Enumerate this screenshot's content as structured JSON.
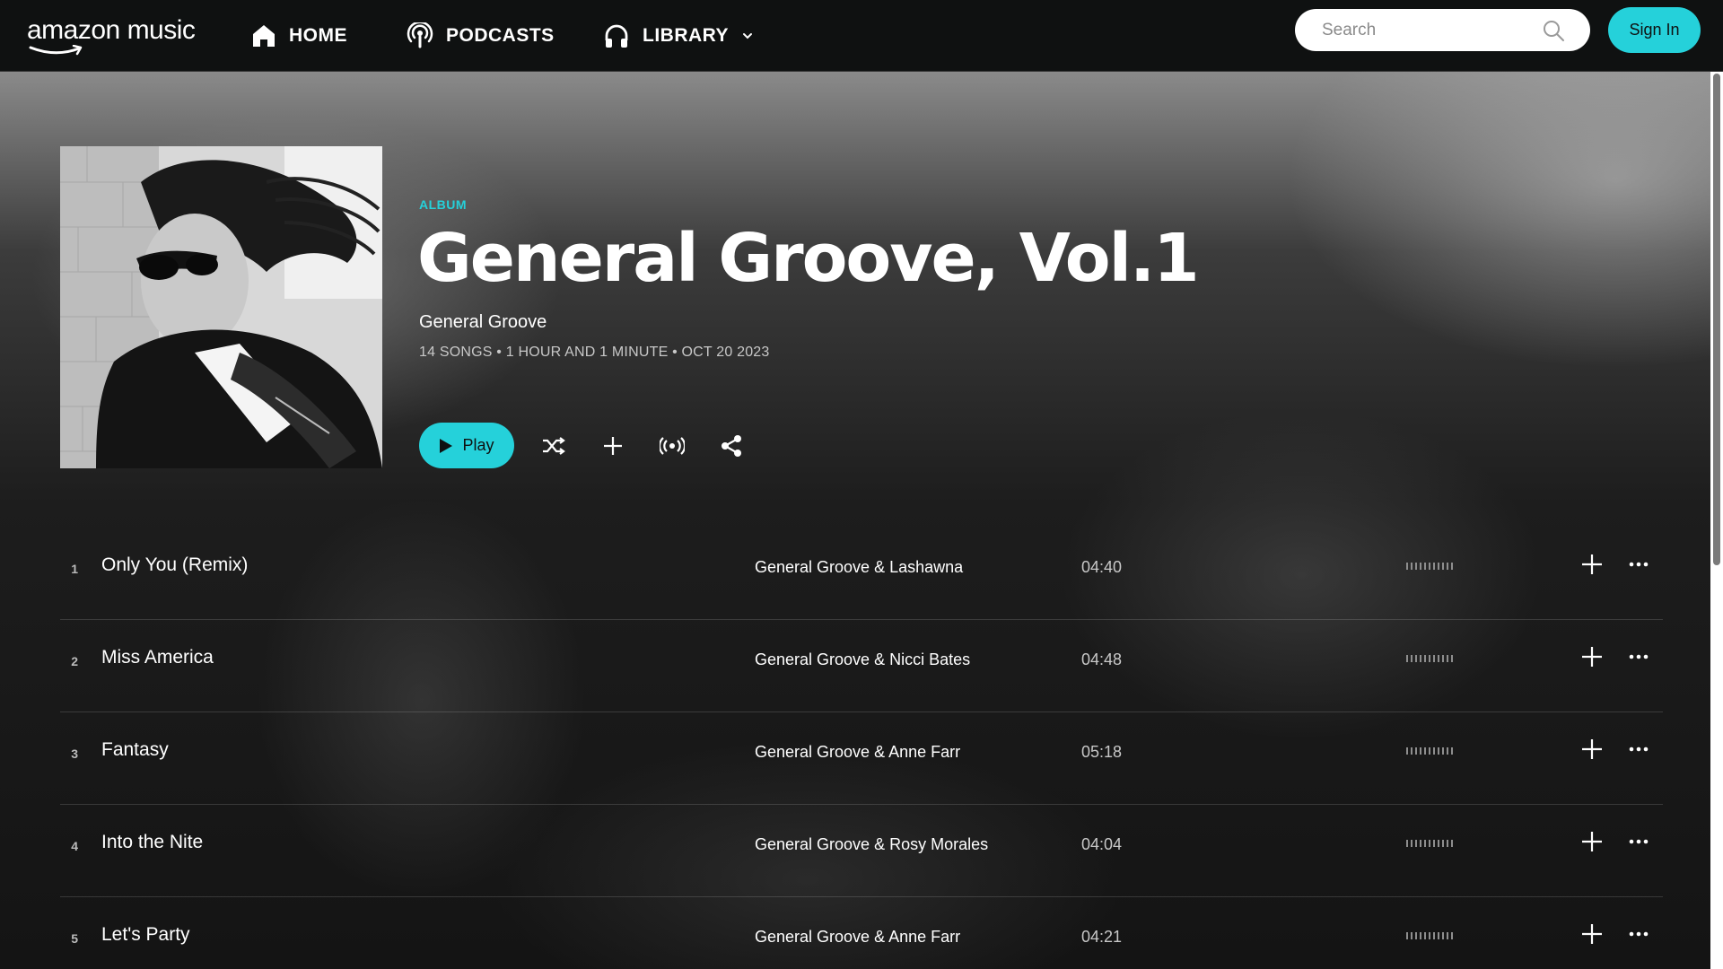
{
  "header": {
    "logo_text": "amazon music",
    "nav": [
      {
        "label": "HOME",
        "icon": "home-icon"
      },
      {
        "label": "PODCASTS",
        "icon": "podcast-icon"
      },
      {
        "label": "LIBRARY",
        "icon": "headphones-icon"
      }
    ],
    "search_placeholder": "Search",
    "signin_label": "Sign In"
  },
  "album": {
    "type_label": "ALBUM",
    "title": "General Groove, Vol.1",
    "artist": "General Groove",
    "meta": "14 SONGS • 1 HOUR AND 1 MINUTE • OCT 20 2023",
    "play_label": "Play"
  },
  "tracks": [
    {
      "num": "1",
      "title": "Only You (Remix)",
      "artist": "General Groove & Lashawna",
      "duration": "04:40"
    },
    {
      "num": "2",
      "title": "Miss America",
      "artist": "General Groove & Nicci Bates",
      "duration": "04:48"
    },
    {
      "num": "3",
      "title": "Fantasy",
      "artist": "General Groove & Anne Farr",
      "duration": "05:18"
    },
    {
      "num": "4",
      "title": "Into the Nite",
      "artist": "General Groove & Rosy Morales",
      "duration": "04:04"
    },
    {
      "num": "5",
      "title": "Let's Party",
      "artist": "General Groove & Anne Farr",
      "duration": "04:21"
    }
  ],
  "colors": {
    "accent": "#25d1da",
    "topbar": "#0f1111"
  }
}
